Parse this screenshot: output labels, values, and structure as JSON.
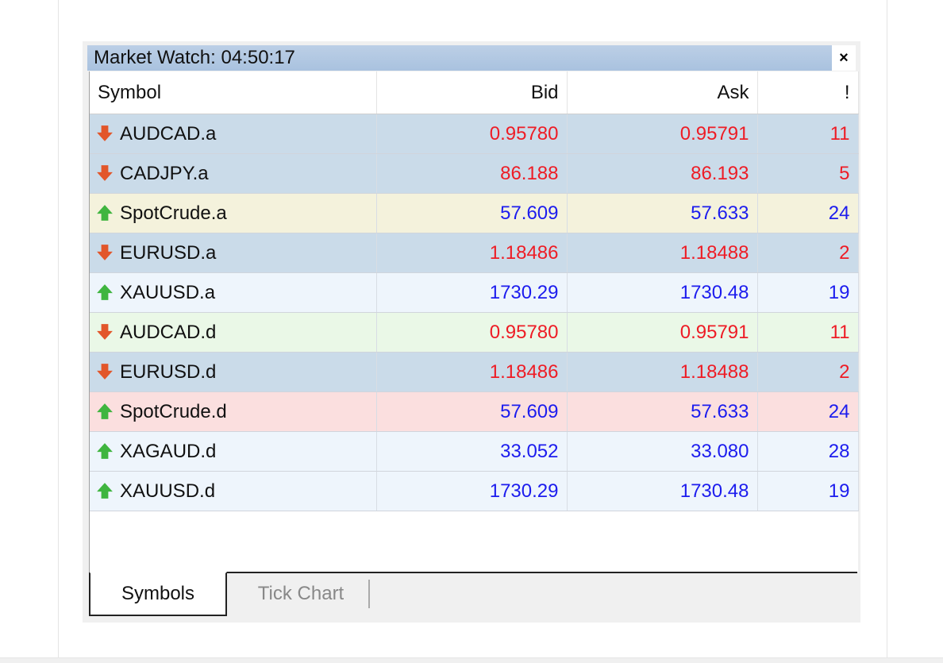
{
  "window": {
    "title": "Market Watch: 04:50:17",
    "close_label": "×"
  },
  "columns": {
    "symbol": "Symbol",
    "bid": "Bid",
    "ask": "Ask",
    "spread": "!"
  },
  "colors": {
    "down": "#ee1c25",
    "up": "#1c1cee",
    "arrow_down": "#e2562a",
    "arrow_up": "#3fb53f"
  },
  "rows": [
    {
      "symbol": "AUDCAD.a",
      "bid": "0.95780",
      "ask": "0.95791",
      "spread": "11",
      "direction": "down",
      "background": "#cadbe9"
    },
    {
      "symbol": "CADJPY.a",
      "bid": "86.188",
      "ask": "86.193",
      "spread": "5",
      "direction": "down",
      "background": "#cadbe9"
    },
    {
      "symbol": "SpotCrude.a",
      "bid": "57.609",
      "ask": "57.633",
      "spread": "24",
      "direction": "up",
      "background": "#f4f2dc"
    },
    {
      "symbol": "EURUSD.a",
      "bid": "1.18486",
      "ask": "1.18488",
      "spread": "2",
      "direction": "down",
      "background": "#cadbe9"
    },
    {
      "symbol": "XAUUSD.a",
      "bid": "1730.29",
      "ask": "1730.48",
      "spread": "19",
      "direction": "up",
      "background": "#eef5fc"
    },
    {
      "symbol": "AUDCAD.d",
      "bid": "0.95780",
      "ask": "0.95791",
      "spread": "11",
      "direction": "down",
      "background": "#eaf8e7"
    },
    {
      "symbol": "EURUSD.d",
      "bid": "1.18486",
      "ask": "1.18488",
      "spread": "2",
      "direction": "down",
      "background": "#cadbe9"
    },
    {
      "symbol": "SpotCrude.d",
      "bid": "57.609",
      "ask": "57.633",
      "spread": "24",
      "direction": "up",
      "background": "#fbdfdf"
    },
    {
      "symbol": "XAGAUD.d",
      "bid": "33.052",
      "ask": "33.080",
      "spread": "28",
      "direction": "up",
      "background": "#eef5fc"
    },
    {
      "symbol": "XAUUSD.d",
      "bid": "1730.29",
      "ask": "1730.48",
      "spread": "19",
      "direction": "up",
      "background": "#eef5fc"
    }
  ],
  "tabs": [
    {
      "label": "Symbols",
      "active": true
    },
    {
      "label": "Tick Chart",
      "active": false
    }
  ]
}
